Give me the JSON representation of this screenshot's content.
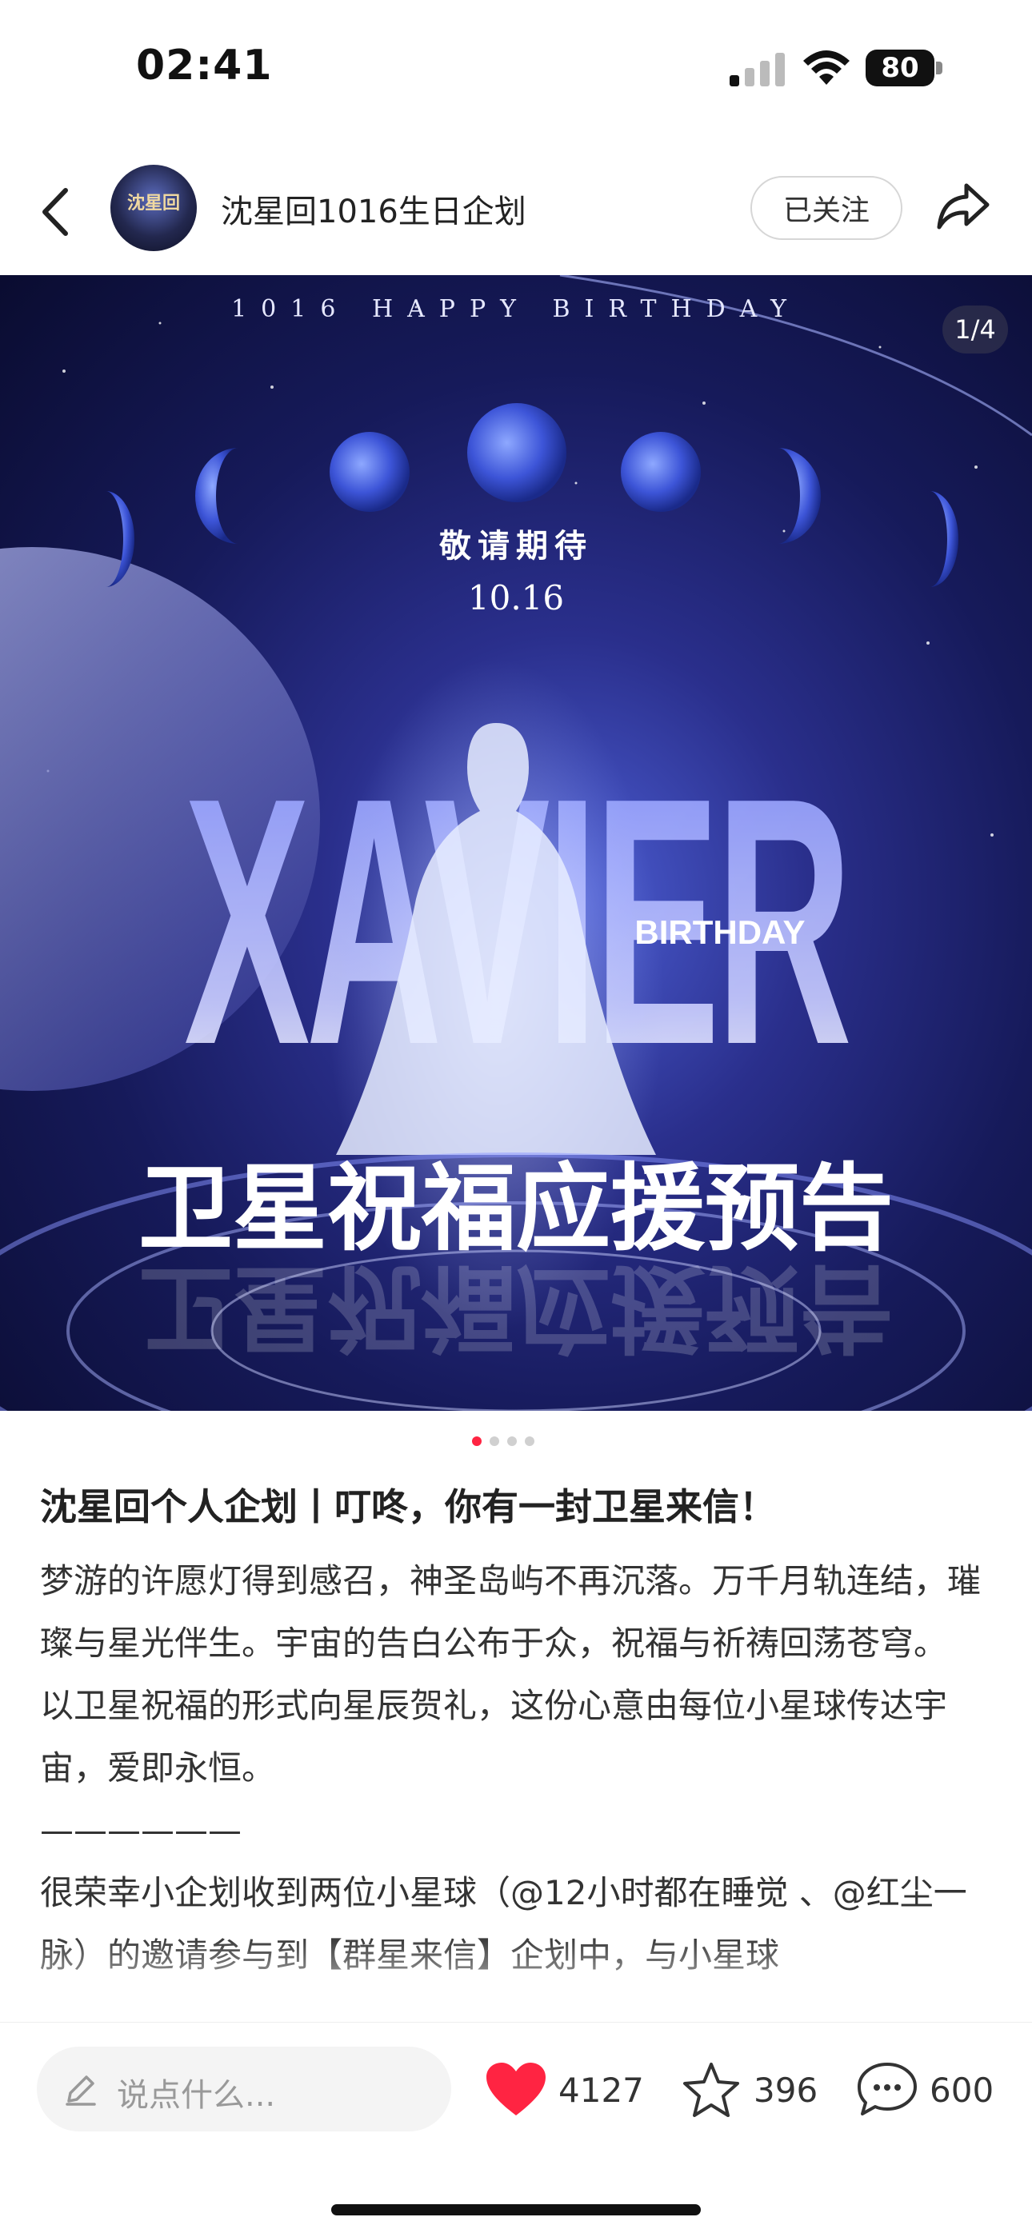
{
  "status": {
    "time": "02:41",
    "battery": "80"
  },
  "header": {
    "avatar_text": "沈星回",
    "account_name": "沈星回1016生日企划",
    "follow_label": "已关注"
  },
  "hero": {
    "page_indicator": "1/4",
    "top_line": "1016   HAPPY   BIRTHDAY",
    "subtitle": "敬请期待",
    "date": "10.16",
    "big_word": "XAVIER",
    "birthday": "BIRTHDAY",
    "banner": "卫星祝福应援预告"
  },
  "post": {
    "title": "沈星回个人企划丨叮咚，你有一封卫星来信！",
    "paragraphs": [
      "梦游的许愿灯得到感召，神圣岛屿不再沉落。万千月轨连结，璀璨与星光伴生。宇宙的告白公布于众，祝福与祈祷回荡苍穹。",
      "以卫星祝福的形式向星辰贺礼，这份心意由每位小星球传达宇宙，爱即永恒。",
      "——————",
      "很荣幸小企划收到两位小星球（@12小时都在睡觉 、@红尘一脉）的邀请参与到【群星来信】企划中，与小星球"
    ]
  },
  "bottom": {
    "comment_placeholder": "说点什么...",
    "likes": "4127",
    "collects": "396",
    "comments": "600"
  },
  "colors": {
    "accent": "#ff2442",
    "hero_blue": "#4d5fd6"
  }
}
